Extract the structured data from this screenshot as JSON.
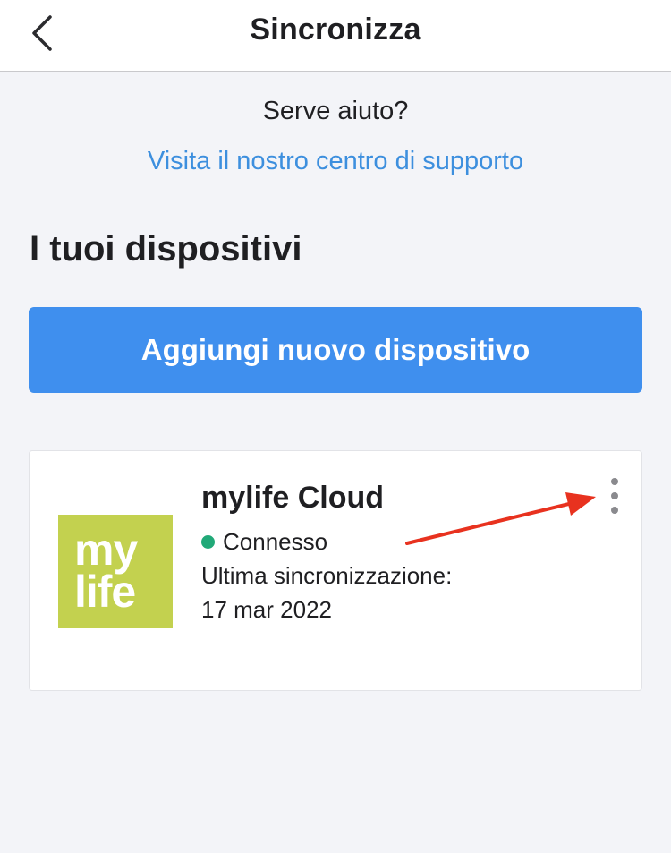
{
  "header": {
    "title": "Sincronizza",
    "back_icon": "chevron-left-icon"
  },
  "help": {
    "question": "Serve aiuto?",
    "link": "Visita il nostro centro di supporto"
  },
  "devices": {
    "section_title": "I tuoi dispositivi",
    "add_button_label": "Aggiungi nuovo dispositivo",
    "items": [
      {
        "logo_text": [
          "my",
          "life"
        ],
        "logo_color": "#c3d14f",
        "name": "mylife Cloud",
        "status": "Connesso",
        "status_color": "#21a978",
        "last_sync_label": "Ultima sincronizzazione:",
        "last_sync_date": "17 mar 2022",
        "menu_icon": "more-vertical-icon"
      }
    ]
  },
  "annotation": {
    "arrow_color": "#e8321f"
  },
  "colors": {
    "accent": "#3f8fee",
    "link": "#3d8fde",
    "background": "#f3f4f8"
  }
}
